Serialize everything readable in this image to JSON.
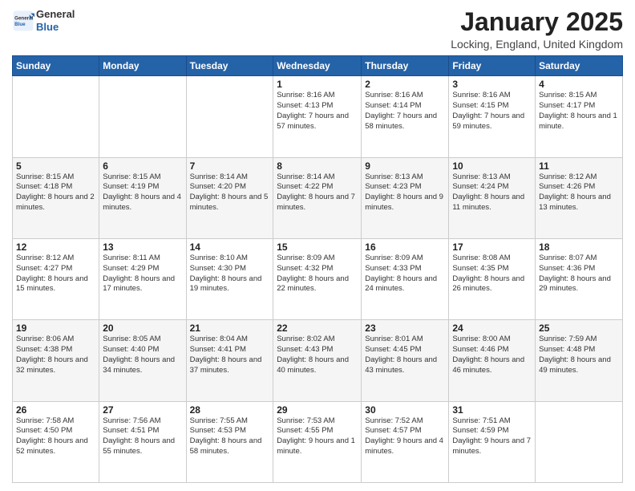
{
  "header": {
    "logo": {
      "general": "General",
      "blue": "Blue"
    },
    "title": "January 2025",
    "subtitle": "Locking, England, United Kingdom"
  },
  "days_of_week": [
    "Sunday",
    "Monday",
    "Tuesday",
    "Wednesday",
    "Thursday",
    "Friday",
    "Saturday"
  ],
  "weeks": [
    [
      {
        "day": "",
        "info": ""
      },
      {
        "day": "",
        "info": ""
      },
      {
        "day": "",
        "info": ""
      },
      {
        "day": "1",
        "info": "Sunrise: 8:16 AM\nSunset: 4:13 PM\nDaylight: 7 hours and 57 minutes."
      },
      {
        "day": "2",
        "info": "Sunrise: 8:16 AM\nSunset: 4:14 PM\nDaylight: 7 hours and 58 minutes."
      },
      {
        "day": "3",
        "info": "Sunrise: 8:16 AM\nSunset: 4:15 PM\nDaylight: 7 hours and 59 minutes."
      },
      {
        "day": "4",
        "info": "Sunrise: 8:15 AM\nSunset: 4:17 PM\nDaylight: 8 hours and 1 minute."
      }
    ],
    [
      {
        "day": "5",
        "info": "Sunrise: 8:15 AM\nSunset: 4:18 PM\nDaylight: 8 hours and 2 minutes."
      },
      {
        "day": "6",
        "info": "Sunrise: 8:15 AM\nSunset: 4:19 PM\nDaylight: 8 hours and 4 minutes."
      },
      {
        "day": "7",
        "info": "Sunrise: 8:14 AM\nSunset: 4:20 PM\nDaylight: 8 hours and 5 minutes."
      },
      {
        "day": "8",
        "info": "Sunrise: 8:14 AM\nSunset: 4:22 PM\nDaylight: 8 hours and 7 minutes."
      },
      {
        "day": "9",
        "info": "Sunrise: 8:13 AM\nSunset: 4:23 PM\nDaylight: 8 hours and 9 minutes."
      },
      {
        "day": "10",
        "info": "Sunrise: 8:13 AM\nSunset: 4:24 PM\nDaylight: 8 hours and 11 minutes."
      },
      {
        "day": "11",
        "info": "Sunrise: 8:12 AM\nSunset: 4:26 PM\nDaylight: 8 hours and 13 minutes."
      }
    ],
    [
      {
        "day": "12",
        "info": "Sunrise: 8:12 AM\nSunset: 4:27 PM\nDaylight: 8 hours and 15 minutes."
      },
      {
        "day": "13",
        "info": "Sunrise: 8:11 AM\nSunset: 4:29 PM\nDaylight: 8 hours and 17 minutes."
      },
      {
        "day": "14",
        "info": "Sunrise: 8:10 AM\nSunset: 4:30 PM\nDaylight: 8 hours and 19 minutes."
      },
      {
        "day": "15",
        "info": "Sunrise: 8:09 AM\nSunset: 4:32 PM\nDaylight: 8 hours and 22 minutes."
      },
      {
        "day": "16",
        "info": "Sunrise: 8:09 AM\nSunset: 4:33 PM\nDaylight: 8 hours and 24 minutes."
      },
      {
        "day": "17",
        "info": "Sunrise: 8:08 AM\nSunset: 4:35 PM\nDaylight: 8 hours and 26 minutes."
      },
      {
        "day": "18",
        "info": "Sunrise: 8:07 AM\nSunset: 4:36 PM\nDaylight: 8 hours and 29 minutes."
      }
    ],
    [
      {
        "day": "19",
        "info": "Sunrise: 8:06 AM\nSunset: 4:38 PM\nDaylight: 8 hours and 32 minutes."
      },
      {
        "day": "20",
        "info": "Sunrise: 8:05 AM\nSunset: 4:40 PM\nDaylight: 8 hours and 34 minutes."
      },
      {
        "day": "21",
        "info": "Sunrise: 8:04 AM\nSunset: 4:41 PM\nDaylight: 8 hours and 37 minutes."
      },
      {
        "day": "22",
        "info": "Sunrise: 8:02 AM\nSunset: 4:43 PM\nDaylight: 8 hours and 40 minutes."
      },
      {
        "day": "23",
        "info": "Sunrise: 8:01 AM\nSunset: 4:45 PM\nDaylight: 8 hours and 43 minutes."
      },
      {
        "day": "24",
        "info": "Sunrise: 8:00 AM\nSunset: 4:46 PM\nDaylight: 8 hours and 46 minutes."
      },
      {
        "day": "25",
        "info": "Sunrise: 7:59 AM\nSunset: 4:48 PM\nDaylight: 8 hours and 49 minutes."
      }
    ],
    [
      {
        "day": "26",
        "info": "Sunrise: 7:58 AM\nSunset: 4:50 PM\nDaylight: 8 hours and 52 minutes."
      },
      {
        "day": "27",
        "info": "Sunrise: 7:56 AM\nSunset: 4:51 PM\nDaylight: 8 hours and 55 minutes."
      },
      {
        "day": "28",
        "info": "Sunrise: 7:55 AM\nSunset: 4:53 PM\nDaylight: 8 hours and 58 minutes."
      },
      {
        "day": "29",
        "info": "Sunrise: 7:53 AM\nSunset: 4:55 PM\nDaylight: 9 hours and 1 minute."
      },
      {
        "day": "30",
        "info": "Sunrise: 7:52 AM\nSunset: 4:57 PM\nDaylight: 9 hours and 4 minutes."
      },
      {
        "day": "31",
        "info": "Sunrise: 7:51 AM\nSunset: 4:59 PM\nDaylight: 9 hours and 7 minutes."
      },
      {
        "day": "",
        "info": ""
      }
    ]
  ]
}
